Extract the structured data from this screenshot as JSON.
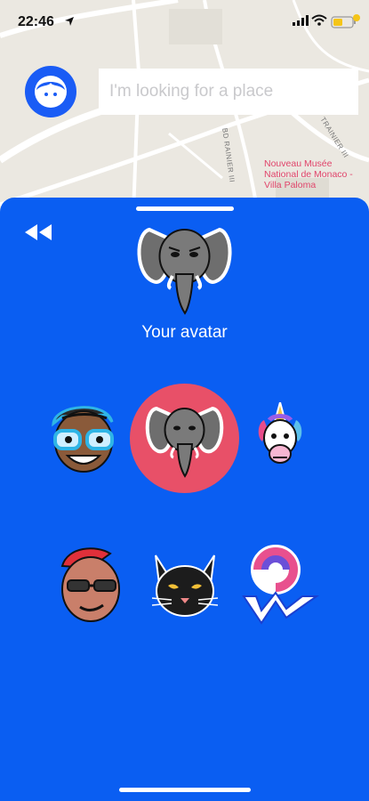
{
  "status_bar": {
    "time": "22:46"
  },
  "search": {
    "placeholder": "I'm looking for a place"
  },
  "map": {
    "poi_label": "Nouveau Musée National de Monaco - Villa Paloma",
    "street_1": "TRAINIER III",
    "street_2": "BD RAINIER III"
  },
  "sheet": {
    "selected_label": "Your avatar",
    "avatars": [
      {
        "name": "glasses guy",
        "selected": false
      },
      {
        "name": "elephant",
        "selected": true
      },
      {
        "name": "unicorn",
        "selected": false
      },
      {
        "name": "mohawk guy",
        "selected": false
      },
      {
        "name": "black cat",
        "selected": false
      },
      {
        "name": "logo",
        "selected": false
      }
    ]
  },
  "colors": {
    "sheet_bg": "#0a5ef2",
    "selected_bg": "#e85068",
    "map_label": "#e0456b"
  }
}
